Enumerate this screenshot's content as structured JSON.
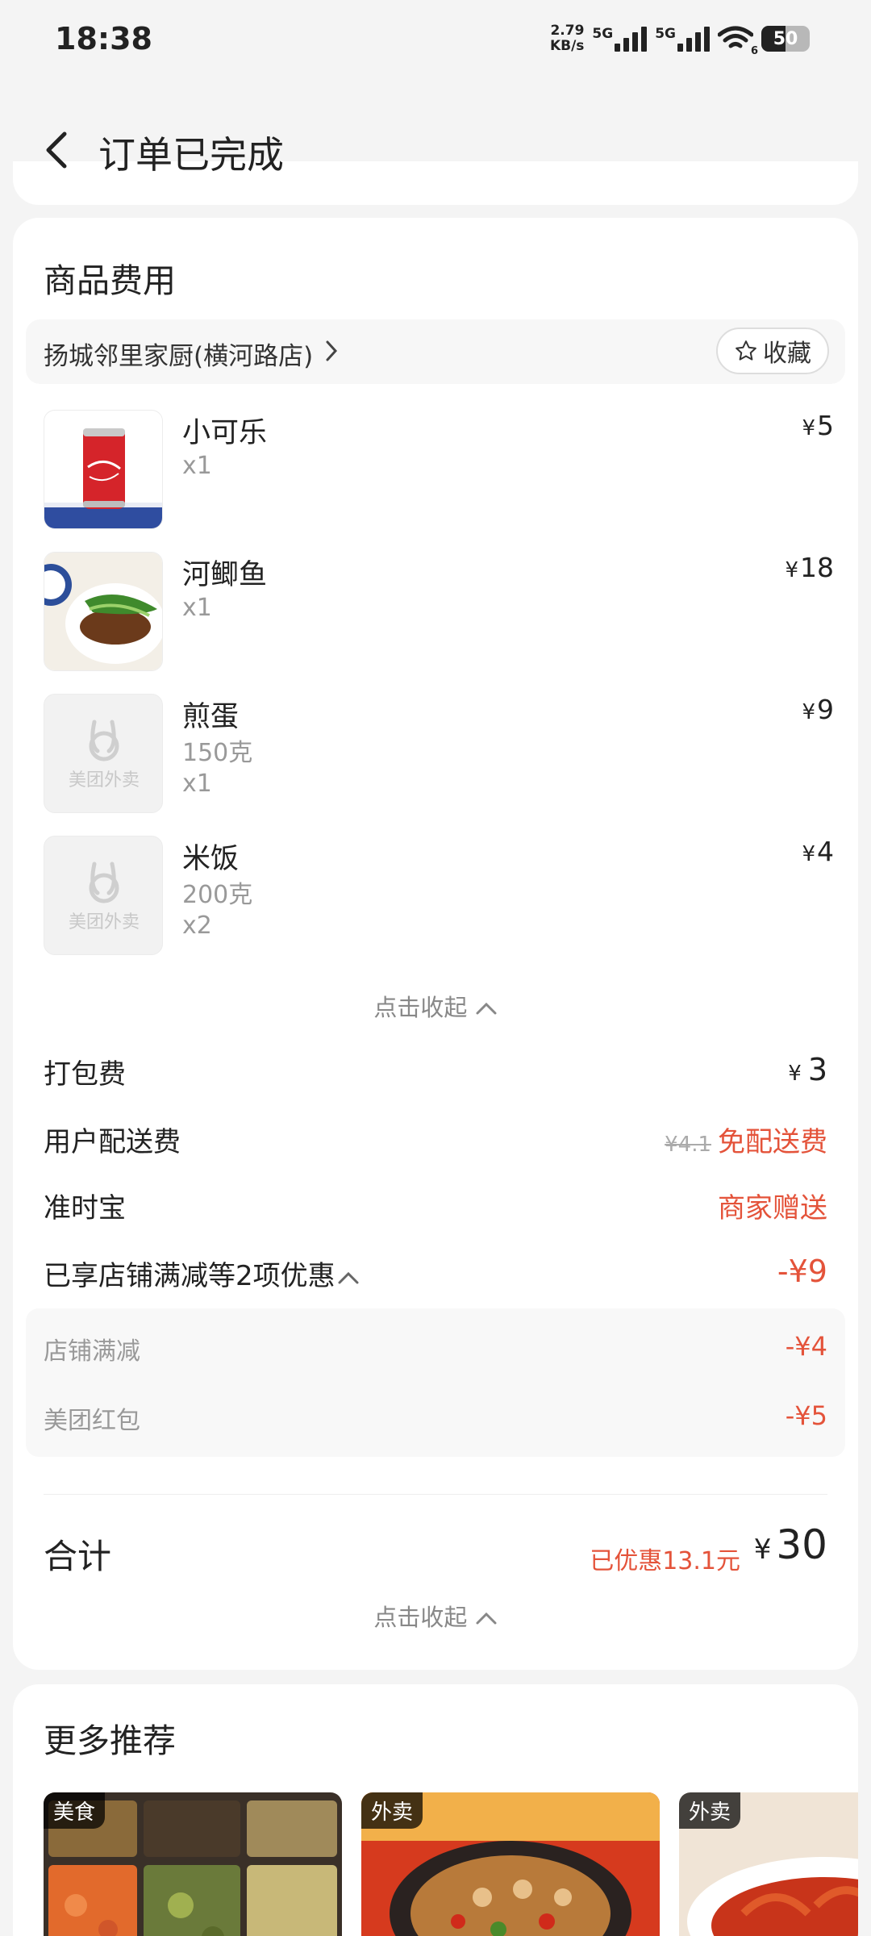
{
  "status_bar": {
    "time": "18:38",
    "net_speed_value": "2.79",
    "net_speed_unit": "KB/s",
    "signal_1_label": "5G",
    "signal_2_label": "5G",
    "wifi_badge": "6",
    "battery": "50"
  },
  "header": {
    "title": "订单已完成"
  },
  "goods_section": {
    "title": "商品费用",
    "store_name": "扬城邻里家厨(横河路店)",
    "favorite_label": "收藏",
    "items": [
      {
        "name": "小可乐",
        "detail": "",
        "qty": "x1",
        "price": "5",
        "image": "coke-can"
      },
      {
        "name": "河鲫鱼",
        "detail": "",
        "qty": "x1",
        "price": "18",
        "image": "fish-dish"
      },
      {
        "name": "煎蛋",
        "detail": "150克",
        "qty": "x1",
        "price": "9",
        "image": "placeholder"
      },
      {
        "name": "米饭",
        "detail": "200克",
        "qty": "x2",
        "price": "4",
        "image": "placeholder"
      }
    ],
    "placeholder_brand": "美团外卖",
    "collapse_items_label": "点击收起"
  },
  "fees": {
    "currency": "¥",
    "packing_label": "打包费",
    "packing_value": "3",
    "delivery_label": "用户配送费",
    "delivery_original": "¥4.1",
    "delivery_value": "免配送费",
    "ontime_label": "准时宝",
    "ontime_value": "商家赠送",
    "discounts_label": "已享店铺满减等2项优惠",
    "discounts_total": "-¥9",
    "discount_items": [
      {
        "label": "店铺满减",
        "value": "-¥4"
      },
      {
        "label": "美团红包",
        "value": "-¥5"
      }
    ]
  },
  "total": {
    "label": "合计",
    "saved": "已优惠13.1元",
    "amount": "30",
    "collapse_label": "点击收起"
  },
  "recommend": {
    "title": "更多推荐",
    "items": [
      {
        "tag": "美食"
      },
      {
        "tag": "外卖"
      },
      {
        "tag": "外卖"
      }
    ]
  },
  "colors": {
    "accent_red": "#e4533a",
    "background": "#f4f4f4",
    "card": "#ffffff"
  }
}
